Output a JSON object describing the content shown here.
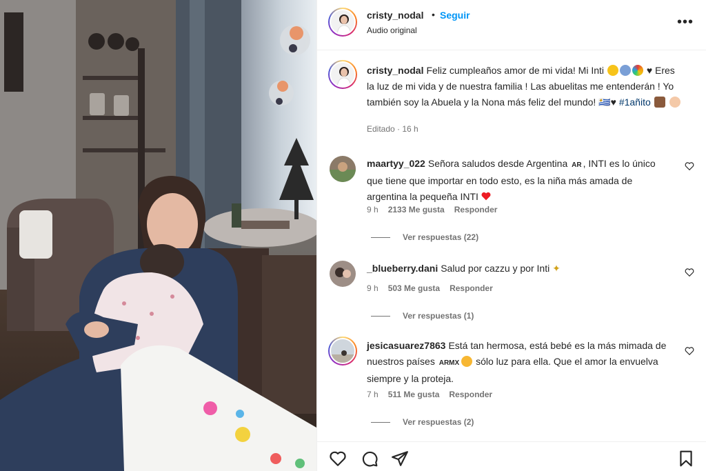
{
  "post": {
    "username": "cristy_nodal",
    "dot": "•",
    "follow_label": "Seguir",
    "audio_label": "Audio original",
    "more_label": "•••"
  },
  "caption": {
    "username": "cristy_nodal",
    "text_1": "Feliz cumpleaños amor de mi vida! Mi Inti",
    "text_2": "♥ Eres la luz de mi vida y de nuestra familia ! Las abuelitas me entenderán ! Yo también soy la Abuela y la Nona más feliz del mundo! 🇺🇾♥",
    "hashtag": "#1añito",
    "edited": "Editado · 16 h"
  },
  "comments": [
    {
      "username": "maartyy_022",
      "text_a": "Señora saludos desde Argentina",
      "flag": "AR",
      "text_b": ", INTI es lo único que tiene que importar en todo esto, es la niña más amada de argentina la pequeña INTI",
      "time": "9 h",
      "likes": "2133 Me gusta",
      "reply_label": "Responder",
      "replies_label": "Ver respuestas (22)"
    },
    {
      "username": "_blueberry.dani",
      "text_a": "Salud por cazzu y por Inti",
      "time": "9 h",
      "likes": "503 Me gusta",
      "reply_label": "Responder",
      "replies_label": "Ver respuestas (1)"
    },
    {
      "username": "jesicasuarez7863",
      "text_a": "Está tan hermosa, está bebé es la más mimada de nuestros países",
      "flag": "ARMX",
      "text_b": "sólo luz para ella. Que el amor la envuelva siempre y la proteja.",
      "time": "7 h",
      "likes": "511 Me gusta",
      "reply_label": "Responder",
      "replies_label": "Ver respuestas (2)"
    }
  ],
  "colors": {
    "link_blue": "#0095f6",
    "hashtag": "#00376b",
    "muted": "#737373",
    "text": "#262626",
    "heart_red": "#ed1c24"
  },
  "icons": [
    "more-icon",
    "heart-icon",
    "comment-icon",
    "share-icon",
    "bookmark-icon",
    "sun-emoji",
    "cake-emoji",
    "prayer-emoji",
    "sparkle-emoji"
  ]
}
